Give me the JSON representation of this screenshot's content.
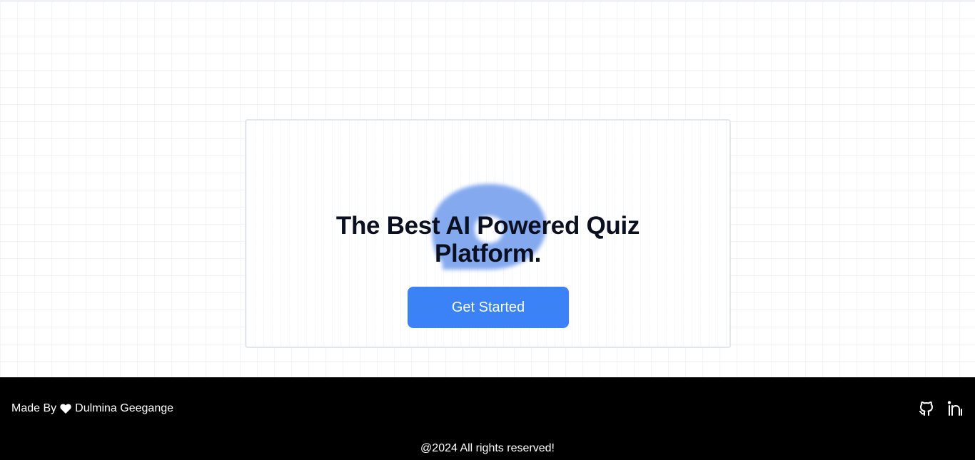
{
  "hero": {
    "headline_line1": "The Best AI Powered Quiz",
    "headline_line2": "Platform.",
    "cta_label": "Get Started"
  },
  "footer": {
    "made_by_prefix": "Made By",
    "heart_icon": "heart-icon",
    "author": "Dulmina Geegange",
    "copyright": "@2024 All rights reserved!",
    "socials": [
      {
        "icon": "github-icon"
      },
      {
        "icon": "linkedin-icon"
      }
    ]
  },
  "colors": {
    "accent": "#3b82f6",
    "blob": "#7aa6f2",
    "footer_bg": "#000000",
    "headline": "#0b1020"
  }
}
